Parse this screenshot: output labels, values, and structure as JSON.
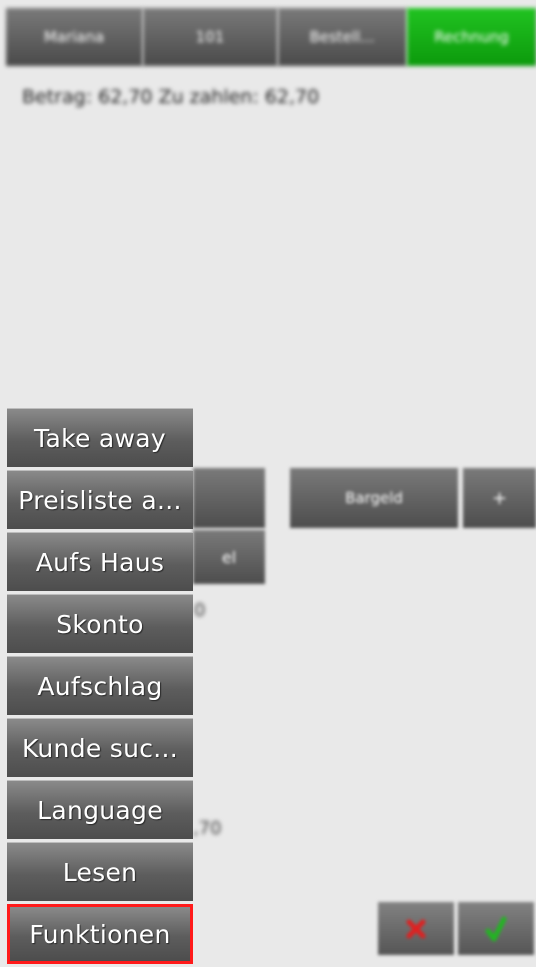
{
  "header": {
    "tabs": [
      "Mariana",
      "101",
      "Bestell...",
      "Rechnung"
    ]
  },
  "summary": {
    "text": "Betrag: 62,70 Zu zahlen: 62,70"
  },
  "payment": {
    "method_label": "Bargeld",
    "add_label": "+",
    "small_label": "el",
    "value_fragment_1": "0",
    "value_fragment_2": ",70"
  },
  "menu": {
    "items": [
      "Take away",
      "Preisliste a...",
      "Aufs Haus",
      "Skonto",
      "Aufschlag",
      "Kunde suc...",
      "Language",
      "Lesen",
      "Funktionen"
    ]
  },
  "actions": {
    "cancel_icon": "x-icon",
    "confirm_icon": "check-icon",
    "cancel_color": "#e02020",
    "confirm_color": "#22b522"
  }
}
